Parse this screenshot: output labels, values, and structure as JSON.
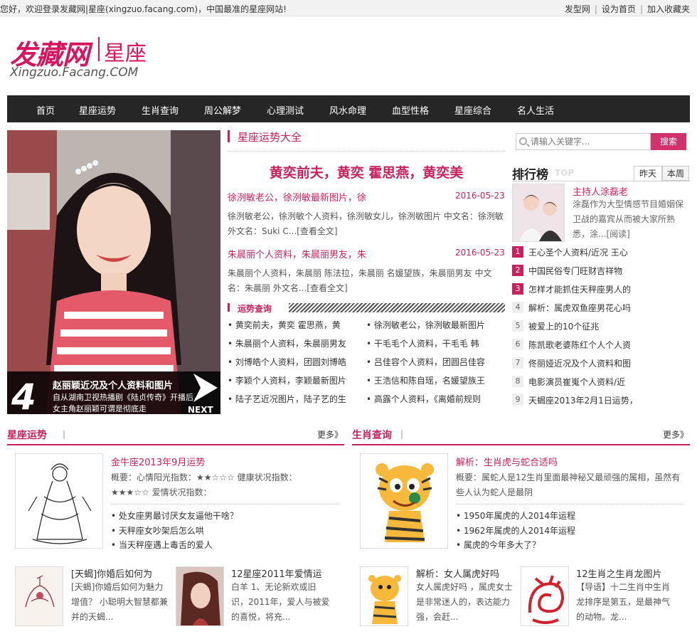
{
  "topbar": {
    "welcome": "您好，欢迎登录发藏网|星座(xingzuo.facang.com)，中国最准的星座网站!",
    "links": [
      "发型网",
      "设为首页",
      "加入收藏夹"
    ]
  },
  "logo": {
    "main": "发藏网",
    "sub": "星座",
    "url": "Xingzuo.Facang.COM"
  },
  "nav": [
    "首页",
    "星座运势",
    "生肖查询",
    "周公解梦",
    "心理测试",
    "风水命理",
    "血型性格",
    "星座综合",
    "名人生活"
  ],
  "hero": {
    "number": "4",
    "title": "赵丽颖近况及个人资料和图片",
    "desc": "自从湖南卫视热播剧《陆贞传奇》开播后，女主角赵丽颖可谓是彻底走",
    "next": "NEXT"
  },
  "middle": {
    "heading": "星座运势大全",
    "headline": "黄奕前夫，黄奕 霍思燕，黄奕美",
    "news": [
      {
        "title": "徐洌敏老公，徐洌敏最新图片，徐",
        "date": "2016-05-23",
        "desc": "徐洌敏老公，徐洌敏个人资料，徐洌敏女儿，徐洌敏图片 中文名：徐洌敏 外文名：Suki C...[查看全文]"
      },
      {
        "title": "朱晨丽个人资料，朱晨丽男友，朱",
        "date": "2016-05-23",
        "desc": "朱晨丽个人资料，朱晨丽 陈法拉，朱晨丽 名媛望族，朱晨丽男友 中文名：朱晨丽 外文名...[查看全文]"
      }
    ],
    "sub_heading": "运势查询",
    "mini_left": [
      "黄奕前夫，黄奕 霍思燕，黄",
      "朱晨丽个人资料，朱晨丽男友",
      "刘博皓个人资料，团圆刘博皓",
      "李颖个人资料，李颖最新图片",
      "陆子艺近况图片，陆子艺的生"
    ],
    "mini_right": [
      "徐洌敏老公，徐洌敏最新图片",
      "干毛毛个人资料，干毛毛 韩",
      "吕佳容个人资料，团圆吕佳容",
      "王浩信和陈自瑶，名媛望族王",
      "高露个人资料，《离婚前规则"
    ]
  },
  "search": {
    "placeholder": "请输入关键字...",
    "button": "搜索"
  },
  "rank": {
    "title": "排行榜",
    "top": "TOP",
    "tabs": [
      "昨天",
      "本周"
    ],
    "feature": {
      "title": "主持人涂磊老",
      "desc": "涂磊作为大型情感节目婚姻保卫战的嘉宾从而被大家所熟悉，涂...[阅读]"
    },
    "items": [
      "王心圣个人资料/近况 王心",
      "中国民俗专门旺财吉祥物",
      "怎样才能抓住天秤座男人的",
      "解析：属虎双鱼座男花心吗",
      "被爱上的10个征兆",
      "陈凯歌老婆陈红个人个人资",
      "佟丽娅近况及个人资料和图",
      "电影演员崔嵬个人资料/近",
      "天蝎座2013年2月1日运势，"
    ],
    "numbers": [
      "1",
      "2",
      "3",
      "4",
      "5",
      "6",
      "7",
      "8",
      "9"
    ]
  },
  "xingzuo": {
    "title": "星座运势",
    "more": "更多》",
    "feature": {
      "title": "金牛座2013年9月运势",
      "desc": "概要：心情阳光指数：★★☆☆☆ 健康状况指数：★★★☆☆ 爱情状况指数："
    },
    "list": [
      "处女座男最讨厌女友逼他干啥？",
      "天秤座女吵架后怎么哄",
      "当天秤座遇上毒舌的爱人"
    ],
    "small": [
      {
        "title": "[天蝎]你婚后如何为",
        "desc": "[天蝎]你婚后如何为魅力增值？ 小聪明大智慧都兼并的天蝎..."
      },
      {
        "title": "12星座2011年爱情运",
        "desc": "白羊 1、无论新欢或旧识，2011年，爱人与被爱的喜悦，将充..."
      }
    ]
  },
  "shengxiao": {
    "title": "生肖查询",
    "more": "更多》",
    "feature": {
      "title": "解析：生肖虎与蛇合适吗",
      "desc": "概要：属蛇人是12生肖里面最神秘又最顽强的属相，虽然有些人认为蛇人是最阴"
    },
    "list": [
      "1950年属虎的人2014年运程",
      "1962年属虎的人2014年运程",
      "属虎的今年多大了？"
    ],
    "small": [
      {
        "title": "解析：女人属虎好吗",
        "desc": "女人属虎好吗 ，属虎女士是非常迷人的，表达能力强，会赶..."
      },
      {
        "title": "12生肖之生肖龙图片",
        "desc": "【导语】十二生肖中生肖龙排序是第五，是最神气的动物。龙..."
      }
    ]
  }
}
